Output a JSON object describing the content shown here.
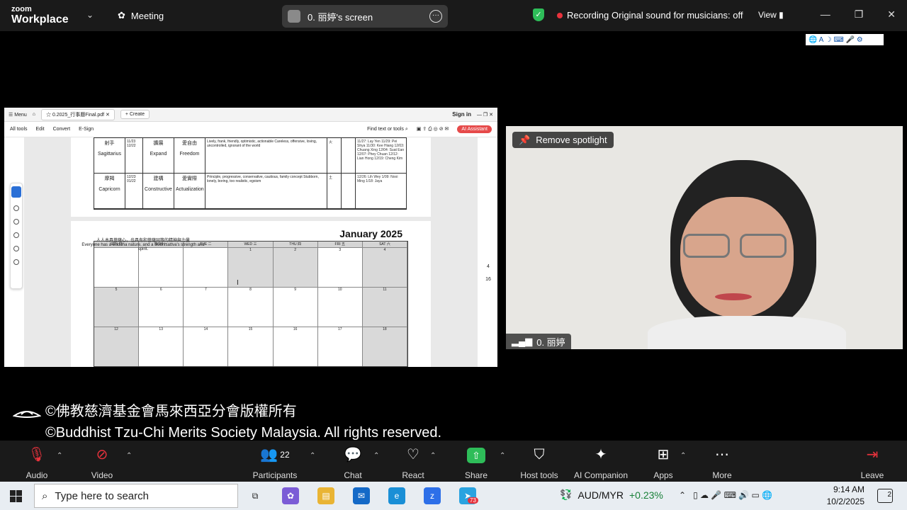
{
  "topbar": {
    "brand_top": "zoom",
    "brand_bottom": "Workplace",
    "meeting_label": "Meeting",
    "screen_label": "0. 丽婷's screen",
    "recording_label": "Recording",
    "original_sound_label": "Original sound for musicians: off",
    "view_label": "View"
  },
  "shared_doc": {
    "menu_label": "Menu",
    "tab_title": "0.2025_行事曆Final.pdf",
    "create_label": "Create",
    "signin_label": "Sign in",
    "tools": [
      "All tools",
      "Edit",
      "Convert",
      "E-Sign"
    ],
    "find_label": "Find text or tools",
    "ai_label": "AI Assistant",
    "zodiac_rows": [
      {
        "name_cn": "射手",
        "name_en": "Sagittarius",
        "dates": "11/23 12/22",
        "trait_cn": "擴展",
        "trait_en": "Expand",
        "value_cn": "愛自由",
        "value_en": "Freedom",
        "desc": "Lively, frank, friendly, optimistic, actionable Careless, offensive, loving, uncontrolled, ignorant of the world",
        "elem": "火",
        "names": "11/27: Lay Yen 11/29: Pei Shya 11/30: Kee Hiang 12/03: Chuang Xing 12/04: Suat Ean 12/07: Phey Chuan 12/12: Lian Hong 12/19: Cheng Kim"
      },
      {
        "name_cn": "摩羯",
        "name_en": "Capricorn",
        "dates": "12/23 01/22",
        "trait_cn": "建構",
        "trait_en": "Constructive",
        "value_cn": "愛實際",
        "value_en": "Actualization",
        "desc": "Principle, progressive, conservative, cautious, family concept Stubborn, lonely, boring, too realistic, egoism",
        "elem": "土",
        "names": "12/26: Lih Wey 1/09: Nooi Ming 1/18: Jaya"
      }
    ],
    "calendar_title": "January 2025",
    "calendar_days": [
      "SUN 日",
      "MON 一",
      "TUE 二",
      "WED 三",
      "THU 四",
      "FRI 五",
      "SAT 六"
    ],
    "calendar_weeks": [
      [
        "",
        "",
        "",
        "1",
        "2",
        "3",
        "4"
      ],
      [
        "5",
        "6",
        "7",
        "8",
        "9",
        "10",
        "11"
      ],
      [
        "12",
        "13",
        "14",
        "15",
        "16",
        "17",
        "18"
      ]
    ],
    "quote_cn": "人人本具菩薩心，也具有和菩薩同等的精神與力量",
    "quote_en": "Everyone has a Buddha nature, and a Bodhisattva's strength and spirit.",
    "page_num": "4",
    "page_total": "16"
  },
  "video": {
    "remove_spotlight_label": "Remove spotlight",
    "participant_name": "0. 丽婷"
  },
  "copyright": {
    "line1": "©佛教慈濟基金會馬來西亞分會版權所有",
    "line2": "©Buddhist Tzu-Chi Merits Society Malaysia. All rights reserved."
  },
  "controls": {
    "audio": "Audio",
    "video": "Video",
    "participants": "Participants",
    "participant_count": "22",
    "chat": "Chat",
    "react": "React",
    "share": "Share",
    "host_tools": "Host tools",
    "ai_companion": "AI Companion",
    "apps": "Apps",
    "more": "More",
    "leave": "Leave"
  },
  "taskbar": {
    "search_placeholder": "Type here to search",
    "telegram_badge": "73",
    "fx_pair": "AUD/MYR",
    "fx_change": "+0.23%",
    "time": "9:14 AM",
    "date": "10/2/2025",
    "notif_count": "2"
  },
  "colors": {
    "recording_dot": "#e8323c",
    "share_green": "#2ebd59",
    "fx_up": "#188038"
  }
}
